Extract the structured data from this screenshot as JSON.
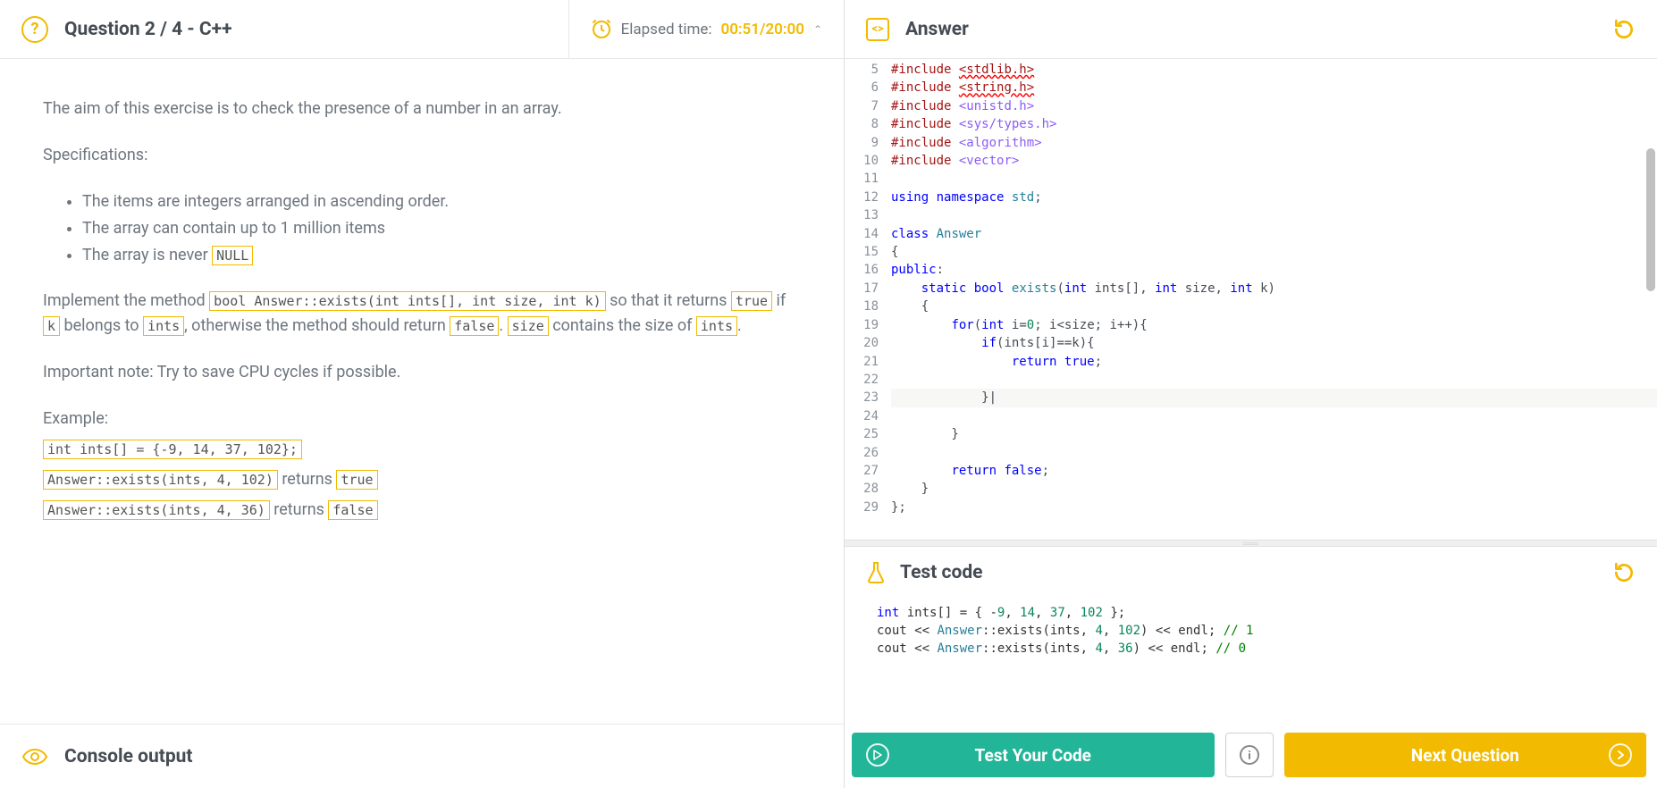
{
  "header": {
    "question_title": "Question 2 / 4 - C++",
    "elapsed_label": "Elapsed time:",
    "elapsed_value": "00:51/20:00"
  },
  "problem": {
    "intro": "The aim of this exercise is to check the presence of a number in an array.",
    "spec_label": "Specifications:",
    "specs": [
      "The items are integers arranged in ascending order.",
      "The array can contain up to 1 million items",
      "The array is never "
    ],
    "spec_null": "NULL",
    "impl_1": "Implement the method ",
    "impl_sig": "bool Answer::exists(int ints[], int size, int k)",
    "impl_2": " so that it returns ",
    "impl_true": "true",
    "impl_3": " if ",
    "impl_k": "k",
    "impl_4": " belongs to ",
    "impl_ints": "ints",
    "impl_5": ", otherwise the method should return ",
    "impl_false": "false",
    "impl_6": ". ",
    "impl_size": "size",
    "impl_7": " contains the size of ",
    "impl_ints2": "ints",
    "impl_8": ".",
    "note": "Important note: Try to save CPU cycles if possible.",
    "example_label": "Example:",
    "ex1": "int ints[] = {-9, 14, 37, 102};",
    "ex2a": "Answer::exists(ints, 4, 102)",
    "ex2b": " returns ",
    "ex2c": "true",
    "ex3a": "Answer::exists(ints, 4, 36)",
    "ex3b": " returns ",
    "ex3c": "false"
  },
  "console": {
    "title": "Console output"
  },
  "answer": {
    "title": "Answer"
  },
  "code_lines": [
    {
      "n": 5,
      "html": "<span class='kw-pre'>#include</span> <span class='kw-err'>&lt;stdlib.h&gt;</span>"
    },
    {
      "n": 6,
      "html": "<span class='kw-pre'>#include</span> <span class='kw-err'>&lt;string.h&gt;</span>"
    },
    {
      "n": 7,
      "html": "<span class='kw-pre'>#include</span> <span class='kw-inc'>&lt;unistd.h&gt;</span>"
    },
    {
      "n": 8,
      "html": "<span class='kw-pre'>#include</span> <span class='kw-inc'>&lt;sys/types.h&gt;</span>"
    },
    {
      "n": 9,
      "html": "<span class='kw-pre'>#include</span> <span class='kw-inc'>&lt;algorithm&gt;</span>"
    },
    {
      "n": 10,
      "html": "<span class='kw-pre'>#include</span> <span class='kw-inc'>&lt;vector&gt;</span>"
    },
    {
      "n": 11,
      "html": ""
    },
    {
      "n": 12,
      "html": "<span class='kw-blue'>using</span> <span class='kw-blue'>namespace</span> <span class='kw-type'>std</span>;"
    },
    {
      "n": 13,
      "html": ""
    },
    {
      "n": 14,
      "html": "<span class='kw-blue'>class</span> <span class='kw-type'>Answer</span>"
    },
    {
      "n": 15,
      "html": "{"
    },
    {
      "n": 16,
      "html": "<span class='kw-blue'>public</span>:"
    },
    {
      "n": 17,
      "html": "    <span class='kw-blue'>static</span> <span class='kw-blue'>bool</span> <span class='kw-type'>exists</span>(<span class='kw-blue'>int</span> ints[], <span class='kw-blue'>int</span> size, <span class='kw-blue'>int</span> k)"
    },
    {
      "n": 18,
      "html": "    {"
    },
    {
      "n": 19,
      "html": "        <span class='kw-blue'>for</span>(<span class='kw-blue'>int</span> i=<span class='kw-num'>0</span>; i&lt;size; i++){"
    },
    {
      "n": 20,
      "html": "            <span class='kw-blue'>if</span>(ints[i]==k){"
    },
    {
      "n": 21,
      "html": "                <span class='kw-blue'>return</span> <span class='kw-blue'>true</span>;"
    },
    {
      "n": 22,
      "html": ""
    },
    {
      "n": 23,
      "html": "            }|",
      "hl": true
    },
    {
      "n": 24,
      "html": ""
    },
    {
      "n": 25,
      "html": "        }"
    },
    {
      "n": 26,
      "html": ""
    },
    {
      "n": 27,
      "html": "        <span class='kw-blue'>return</span> <span class='kw-blue'>false</span>;"
    },
    {
      "n": 28,
      "html": "    }"
    },
    {
      "n": 29,
      "html": "};"
    }
  ],
  "test": {
    "title": "Test code",
    "code_html": "<span class='tc-kw'>int</span> ints[] = { -<span class='tc-num'>9</span>, <span class='tc-num'>14</span>, <span class='tc-num'>37</span>, <span class='tc-num'>102</span> };\ncout &lt;&lt; <span class='tc-type'>Answer</span>::exists(ints, <span class='tc-num'>4</span>, <span class='tc-num'>102</span>) &lt;&lt; endl; <span class='tc-cm'>// 1</span>\ncout &lt;&lt; <span class='tc-type'>Answer</span>::exists(ints, <span class='tc-num'>4</span>, <span class='tc-num'>36</span>) &lt;&lt; endl; <span class='tc-cm'>// 0</span>"
  },
  "buttons": {
    "test": "Test Your Code",
    "next": "Next Question"
  }
}
